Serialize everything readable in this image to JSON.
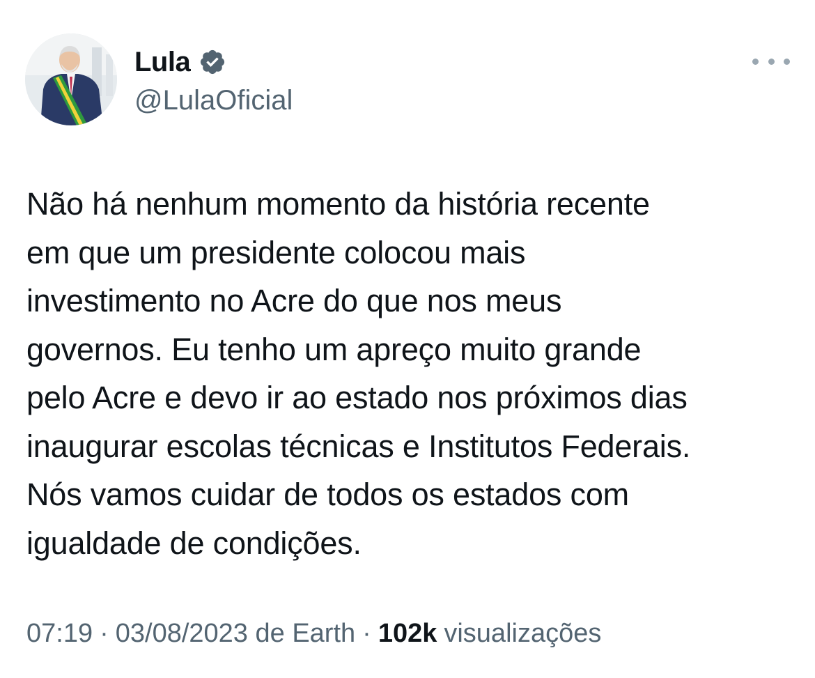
{
  "author": {
    "display_name": "Lula",
    "handle": "@LulaOficial",
    "verified_icon": "verified-badge-icon",
    "badge_color": "#536471"
  },
  "menu": {
    "icon": "more-options-icon"
  },
  "tweet": {
    "text_lines": [
      "Não há nenhum momento da história recente",
      "em que um presidente colocou mais",
      "investimento no Acre do que nos meus",
      "governos. Eu tenho um apreço muito grande",
      "pelo Acre e devo ir ao estado nos próximos dias",
      "inaugurar escolas técnicas e Institutos Federais.",
      "Nós vamos cuidar de todos os estados com",
      "igualdade de condições."
    ]
  },
  "meta": {
    "time": "07:19",
    "separator": "·",
    "date_source": "03/08/2023 de Earth",
    "views_count": "102k",
    "views_label": "visualizações"
  },
  "colors": {
    "text": "#0f1419",
    "secondary": "#536471",
    "background": "#ffffff"
  }
}
